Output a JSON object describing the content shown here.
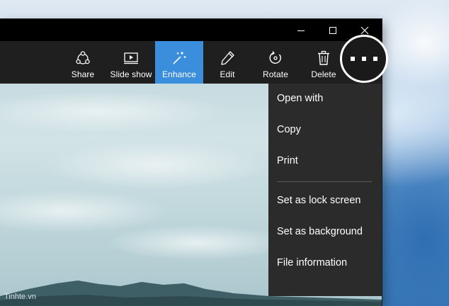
{
  "toolbar": {
    "items": [
      {
        "label": "Share",
        "icon": "share-icon"
      },
      {
        "label": "Slide show",
        "icon": "slideshow-icon"
      },
      {
        "label": "Enhance",
        "icon": "magic-wand-icon",
        "active": true
      },
      {
        "label": "Edit",
        "icon": "pencil-icon"
      },
      {
        "label": "Rotate",
        "icon": "rotate-icon"
      },
      {
        "label": "Delete",
        "icon": "trash-icon"
      }
    ],
    "more_icon": "more-ellipsis-icon"
  },
  "window_controls": {
    "minimize": "minimize-icon",
    "maximize": "maximize-icon",
    "close": "close-icon"
  },
  "menu": {
    "items": [
      {
        "label": "Open with"
      },
      {
        "label": "Copy"
      },
      {
        "label": "Print"
      },
      {
        "label": "Set as lock screen"
      },
      {
        "label": "Set as background"
      },
      {
        "label": "File information"
      }
    ]
  },
  "watermark": "Tinhte.vn",
  "colors": {
    "accent": "#3a8edb",
    "toolbar_bg": "#1f1f1f",
    "menu_bg": "#2b2b2b",
    "titlebar_bg": "#000000"
  }
}
